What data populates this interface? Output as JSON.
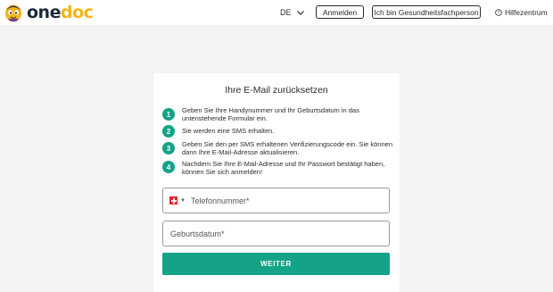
{
  "header": {
    "logo_text_one": "one",
    "logo_text_doc": "doc",
    "language": "DE",
    "login_label": "Anmelden",
    "pro_label": "Ich bin Gesundheitsfachperson",
    "help_label": "Hilfezentrum"
  },
  "card": {
    "title": "Ihre E-Mail zurücksetzen",
    "steps": [
      {
        "number": "1",
        "text": "Geben Sie Ihre Handynummer und Ihr Geburtsdatum in das untenstehende Formular ein."
      },
      {
        "number": "2",
        "text": "Sie werden eine SMS erhalten."
      },
      {
        "number": "3",
        "text": "Geben Sie den per SMS erhaltenen Verifizierungscode ein. Sie können dann Ihre E-Mail-Adresse aktualisieren."
      },
      {
        "number": "4",
        "text": "Nachdem Sie Ihre E-Mail-Adresse und Ihr Passwort bestätigt haben, können Sie sich anmelden!"
      }
    ],
    "phone_placeholder": "Telefonnummer*",
    "country_flag": "switzerland-flag-icon",
    "birthdate_placeholder": "Geburtsdatum*",
    "submit_label": "WEITER"
  },
  "colors": {
    "accent": "#14a386",
    "brand_dark": "#1b2a3a",
    "brand_yellow": "#f4b51c",
    "background": "#f3f3f3"
  }
}
